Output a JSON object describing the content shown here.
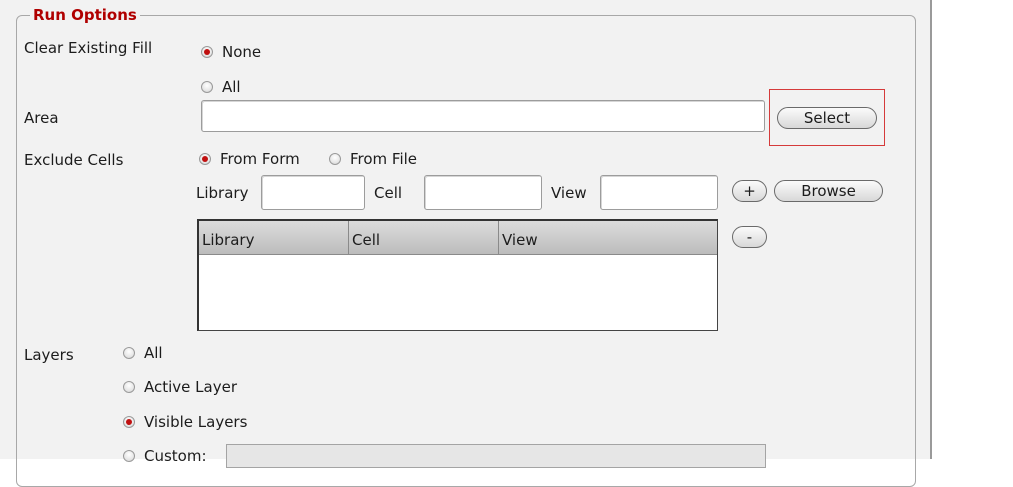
{
  "run_options": {
    "title": "Run Options",
    "clear_fill": {
      "label": "Clear Existing Fill",
      "options": [
        {
          "label": "None",
          "selected": true
        },
        {
          "label": "All",
          "selected": false
        }
      ]
    },
    "area": {
      "label": "Area",
      "value": "",
      "select_button": "Select"
    },
    "exclude_cells": {
      "label": "Exclude Cells",
      "options": [
        {
          "label": "From Form",
          "selected": true
        },
        {
          "label": "From File",
          "selected": false
        }
      ],
      "library_label": "Library",
      "cell_label": "Cell",
      "view_label": "View",
      "add_button": "+",
      "browse_button": "Browse",
      "remove_button": "-",
      "table_columns": [
        "Library",
        "Cell",
        "View"
      ],
      "table_rows": []
    },
    "layers": {
      "label": "Layers",
      "options": [
        {
          "label": "All",
          "selected": false
        },
        {
          "label": "Active Layer",
          "selected": false
        },
        {
          "label": "Visible Layers",
          "selected": true
        },
        {
          "label": "Custom:",
          "selected": false
        }
      ]
    }
  },
  "colors": {
    "title_red": "#b00000",
    "highlight_red": "#d53a3a",
    "radio_selected": "#c01010",
    "panel_bg": "#f2f2f2"
  }
}
